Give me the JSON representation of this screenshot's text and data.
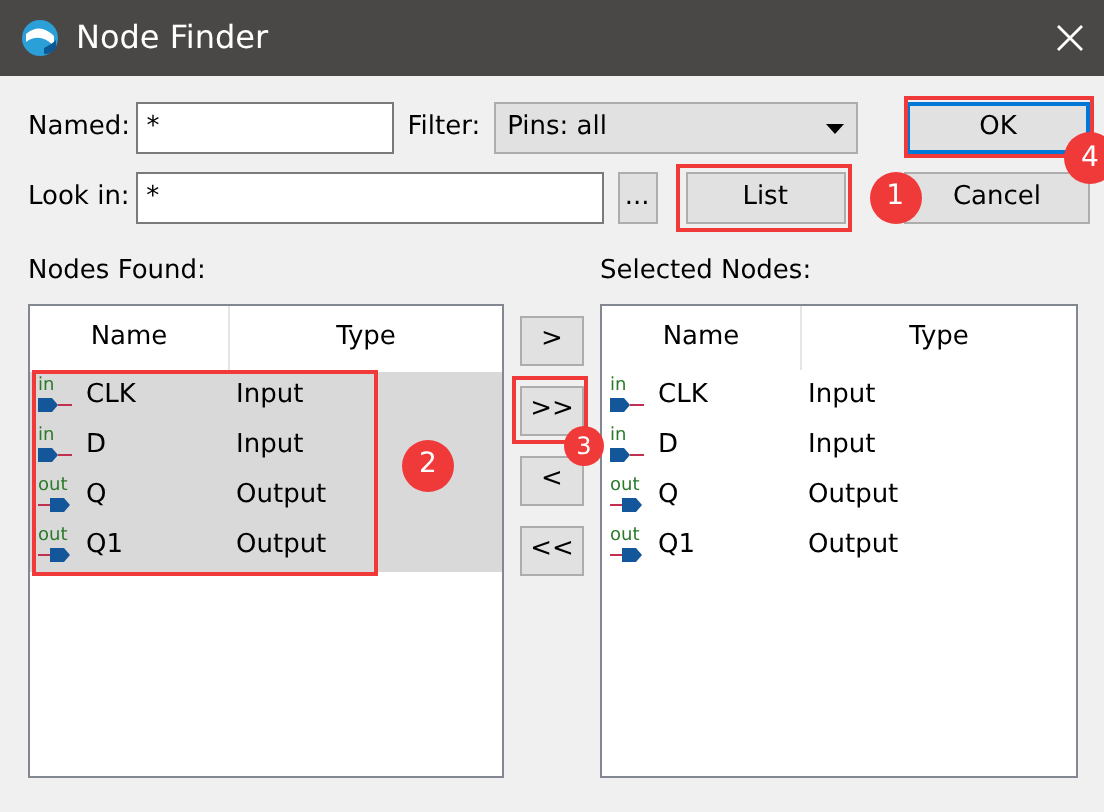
{
  "window": {
    "title": "Node Finder"
  },
  "named": {
    "label": "Named:",
    "value": "*"
  },
  "filter": {
    "label": "Filter:",
    "value": "Pins: all"
  },
  "look_in": {
    "label": "Look in:",
    "value": "*",
    "browse": "..."
  },
  "buttons": {
    "ok": {
      "label": "OK",
      "annotation": "4"
    },
    "list": {
      "label": "List",
      "annotation": "1"
    },
    "cancel": {
      "label": "Cancel"
    }
  },
  "nodes_found": {
    "title": "Nodes Found:",
    "columns": [
      "Name",
      "Type"
    ],
    "rows_annotation": "2",
    "rows": [
      {
        "direction": "in",
        "name": "CLK",
        "type": "Input",
        "selected": true
      },
      {
        "direction": "in",
        "name": "D",
        "type": "Input",
        "selected": true
      },
      {
        "direction": "out",
        "name": "Q",
        "type": "Output",
        "selected": true
      },
      {
        "direction": "out",
        "name": "Q1",
        "type": "Output",
        "selected": true
      }
    ]
  },
  "transfer_buttons": [
    {
      "label": ">"
    },
    {
      "label": ">>",
      "annotation": "3"
    },
    {
      "label": "<"
    },
    {
      "label": "<<"
    }
  ],
  "selected_nodes": {
    "title": "Selected Nodes:",
    "columns": [
      "Name",
      "Type"
    ],
    "rows": [
      {
        "direction": "in",
        "name": "CLK",
        "type": "Input",
        "selected": false
      },
      {
        "direction": "in",
        "name": "D",
        "type": "Input",
        "selected": false
      },
      {
        "direction": "out",
        "name": "Q",
        "type": "Output",
        "selected": false
      },
      {
        "direction": "out",
        "name": "Q1",
        "type": "Output",
        "selected": false
      }
    ]
  }
}
